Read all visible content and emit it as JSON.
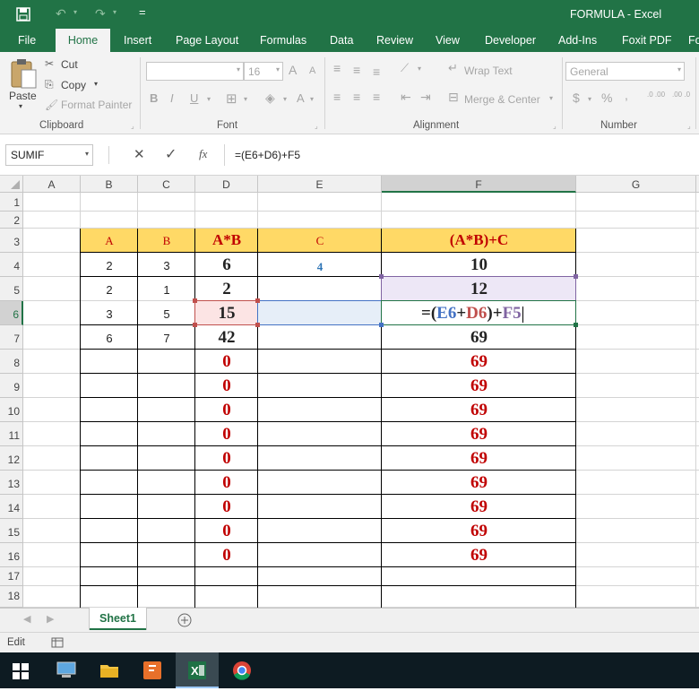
{
  "title": "FORMULA - Excel",
  "qat": {
    "customize": "="
  },
  "tabs": [
    "File",
    "Home",
    "Insert",
    "Page Layout",
    "Formulas",
    "Data",
    "Review",
    "View",
    "Developer",
    "Add-Ins",
    "Foxit PDF",
    "Fo"
  ],
  "ribbon": {
    "clipboard": {
      "paste": "Paste",
      "cut": "Cut",
      "copy": "Copy",
      "format_painter": "Format Painter",
      "label": "Clipboard"
    },
    "font": {
      "size": "16",
      "bold": "B",
      "italic": "I",
      "underline": "U",
      "grow": "A",
      "shrink": "A",
      "color": "A",
      "label": "Font"
    },
    "alignment": {
      "wrap": "Wrap Text",
      "merge": "Merge & Center",
      "label": "Alignment"
    },
    "number": {
      "format": "General",
      "currency": "$",
      "percent": "%",
      "comma": ",",
      "inc": ".0 .00",
      "dec": ".00 .0",
      "label": "Number"
    }
  },
  "formula_bar": {
    "name_box": "SUMIF",
    "fx": "fx",
    "formula": "=(E6+D6)+F5"
  },
  "columns": [
    "A",
    "B",
    "C",
    "D",
    "E",
    "F",
    "G"
  ],
  "rows": [
    "1",
    "2",
    "3",
    "4",
    "5",
    "6",
    "7",
    "8",
    "9",
    "10",
    "11",
    "12",
    "13",
    "14",
    "15",
    "16",
    "17",
    "18"
  ],
  "headers": {
    "a": "A",
    "b": "B",
    "d": "A*B",
    "e": "C",
    "f": "(A*B)+C"
  },
  "data": {
    "r4": {
      "a": "2",
      "b": "3",
      "d": "6",
      "e": "4",
      "f": "10"
    },
    "r5": {
      "a": "2",
      "b": "1",
      "d": "2",
      "f": "12"
    },
    "r6": {
      "a": "3",
      "b": "5",
      "d": "15"
    },
    "r7": {
      "a": "6",
      "b": "7",
      "d": "42",
      "f": "69"
    },
    "zeros": [
      "0",
      "0",
      "0",
      "0",
      "0",
      "0",
      "0",
      "0",
      "0"
    ],
    "f_red": [
      "69",
      "69",
      "69",
      "69",
      "69",
      "69",
      "69",
      "69",
      "69"
    ]
  },
  "edit_formula": {
    "p1": "=(",
    "ref1": "E6",
    "op1": "+",
    "ref2": "D6",
    "p2": ")+",
    "ref3": "F5"
  },
  "sheet_tab": "Sheet1",
  "status": "Edit",
  "colors": {
    "green": "#217346",
    "header_fill": "#ffd966",
    "red": "#c00000",
    "blue_ref": "#4472c4",
    "red_ref": "#c0504d",
    "purple_ref": "#8064a2"
  }
}
